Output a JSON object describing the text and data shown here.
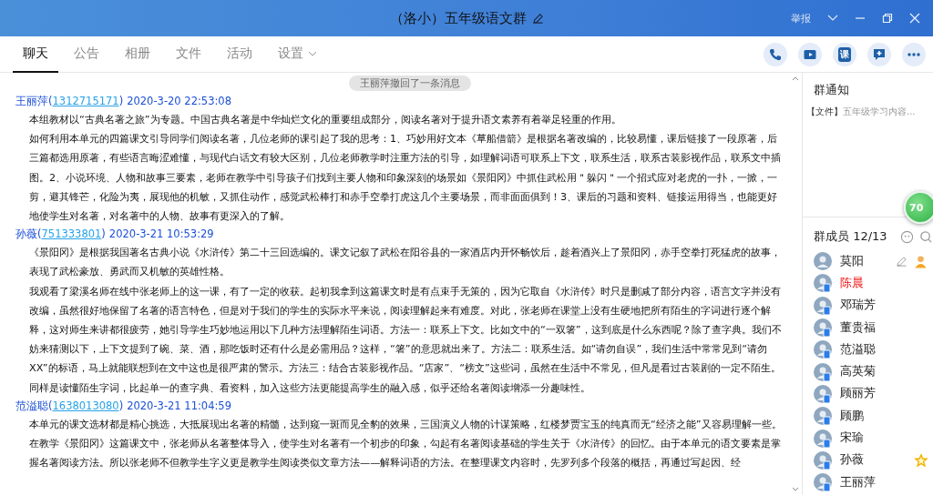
{
  "window": {
    "title": "（洛小）五年级语文群",
    "report": "举报"
  },
  "tabs": [
    {
      "label": "聊天",
      "selected": true
    },
    {
      "label": "公告",
      "selected": false
    },
    {
      "label": "相册",
      "selected": false
    },
    {
      "label": "文件",
      "selected": false
    },
    {
      "label": "活动",
      "selected": false
    },
    {
      "label": "设置",
      "selected": false,
      "dropdown": true
    }
  ],
  "toolbar": [
    {
      "kind": "phone"
    },
    {
      "kind": "video"
    },
    {
      "kind": "text",
      "label": "课"
    },
    {
      "kind": "add"
    },
    {
      "kind": "more"
    }
  ],
  "chat": {
    "notice": "王丽萍撤回了一条消息",
    "messages": [
      {
        "sender": "王丽萍",
        "open": "(",
        "id": "1312715171",
        "close": ")",
        "time": "2020-3-20 22:53:08",
        "paragraphs": [
          "本组教材以“古典名著之旅”为专题。中国古典名著是中华灿烂文化的重要组成部分，阅读名著对于提升语文素养有着举足轻重的作用。",
          "如何利用本单元的四篇课文引导同学们阅读名著，几位老师的课引起了我的思考：1、巧妙用好文本《草船借箭》是根据名著改编的，比较易懂，课后链接了一段原著，后三篇都选用原著，有些语言晦涩难懂，与现代白话文有较大区别，几位老师教学时注重方法的引导，如理解词语可联系上下文，联系生活，联系古装影视作品，联系文中插图。2、小说环境、人物和故事三要素，老师在教学中引导孩子们找到主要人物和印象深刻的场景如《景阳冈》中抓住武松用＂躲闪＂一个招式应对老虎的一扑，一掀，一剪，避其锋芒，化险为夷，展现他的机敏，又抓住动作，感觉武松棒打和赤手空拳打虎这几个主要场景，而非面面俱到！3、课后的习题和资料、链接运用得当，也能更好地使学生对名著，对名著中的人物、故事有更深入的了解。"
        ]
      },
      {
        "sender": "孙薇",
        "open": "(",
        "id": "751333801",
        "close": ")",
        "time": "2020-3-21 10:53:29",
        "paragraphs": [
          "《景阳冈》是根据我国著名古典小说《水浒传》第二十三回选编的。课文记叙了武松在阳谷县的一家酒店内开怀畅饮后，趁着酒兴上了景阳冈，赤手空拳打死猛虎的故事，表现了武松豪放、勇武而又机敏的英雄性格。",
          "我观看了梁溪名师在线中张老师上的这一课，有了一定的收获。起初我拿到这篇课文时是有点束手无策的，因为它取自《水浒传》时只是删减了部分内容，语言文字并没有改编，虽然很好地保留了名著的语言特色，但是对于我们的学生的实际水平来说，阅读理解起来有难度。对此，张老师在课堂上没有生硬地把所有陌生的字词进行逐个解释，这对师生来讲都很疲劳，她引导学生巧妙地运用以下几种方法理解陌生词语。方法一：联系上下文。比如文中的“一双箸”，这到底是什么东西呢？除了查字典。我们不妨来猜测以下，上下文提到了碗、菜、酒，那吃饭时还有什么是必需用品？这样，“箸”的意思就出来了。方法二：联系生活。如“请勿自误”，我们生活中常常见到“请勿XX”的标语，马上就能联想到在文中这也是很严肃的警示。方法三：结合古装影视作品。“店家”、“榜文”这些词，虽然在生活中不常见，但凡是看过古装剧的一定不陌生。同样是读懂陌生字词，比起单一的查字典、看资料，加入这些方法更能提高学生的融入感，似乎还给名著阅读增添一分趣味性。"
        ]
      },
      {
        "sender": "范溢聪",
        "open": "(",
        "id": "1638013080",
        "close": ")",
        "time": "2020-3-21 11:04:59",
        "paragraphs": [
          "本单元的课文选材都是精心挑选，大抵展现出名著的精髓，达到窥一斑而见全豹的效果，三国演义人物的计谋策略，红楼梦贾宝玉的纯真而无“经济之能”又容易理解一些。",
          "在教学《景阳冈》这篇课文中，张老师从名著整体导入，使学生对名著有一个初步的印象，勾起有名著阅读基础的学生关于《水浒传》的回忆。由于本单元的语文要素是掌握名著阅读方法。所以张老师不但教学生字义更是教学生阅读类似文章方法——解释词语的方法。在整理课文内容时，先罗列多个段落的概括，再通过写起因、经"
        ]
      }
    ]
  },
  "group_notice": {
    "title": "群通知",
    "tag": "【文件】",
    "text": "五年级学习内容..."
  },
  "float_ball": {
    "label": "70"
  },
  "members": {
    "title": "群成员 12/13",
    "list": [
      {
        "name": "莫阳",
        "owner": true,
        "admin": false,
        "mobile": false,
        "highlighted": false
      },
      {
        "name": "陈晨",
        "owner": false,
        "admin": false,
        "mobile": true,
        "highlighted": true
      },
      {
        "name": "邓瑞芳",
        "owner": false,
        "admin": false,
        "mobile": true,
        "highlighted": false
      },
      {
        "name": "董贵福",
        "owner": false,
        "admin": false,
        "mobile": true,
        "highlighted": false
      },
      {
        "name": "范溢聪",
        "owner": false,
        "admin": false,
        "mobile": true,
        "highlighted": false
      },
      {
        "name": "高英菊",
        "owner": false,
        "admin": false,
        "mobile": true,
        "highlighted": false
      },
      {
        "name": "顾丽芳",
        "owner": false,
        "admin": false,
        "mobile": true,
        "highlighted": false
      },
      {
        "name": "顾鹏",
        "owner": false,
        "admin": false,
        "mobile": true,
        "highlighted": false
      },
      {
        "name": "宋瑜",
        "owner": false,
        "admin": false,
        "mobile": true,
        "highlighted": false
      },
      {
        "name": "孙薇",
        "owner": false,
        "admin": true,
        "mobile": true,
        "highlighted": false
      },
      {
        "name": "王丽萍",
        "owner": false,
        "admin": false,
        "mobile": true,
        "highlighted": false
      }
    ]
  }
}
